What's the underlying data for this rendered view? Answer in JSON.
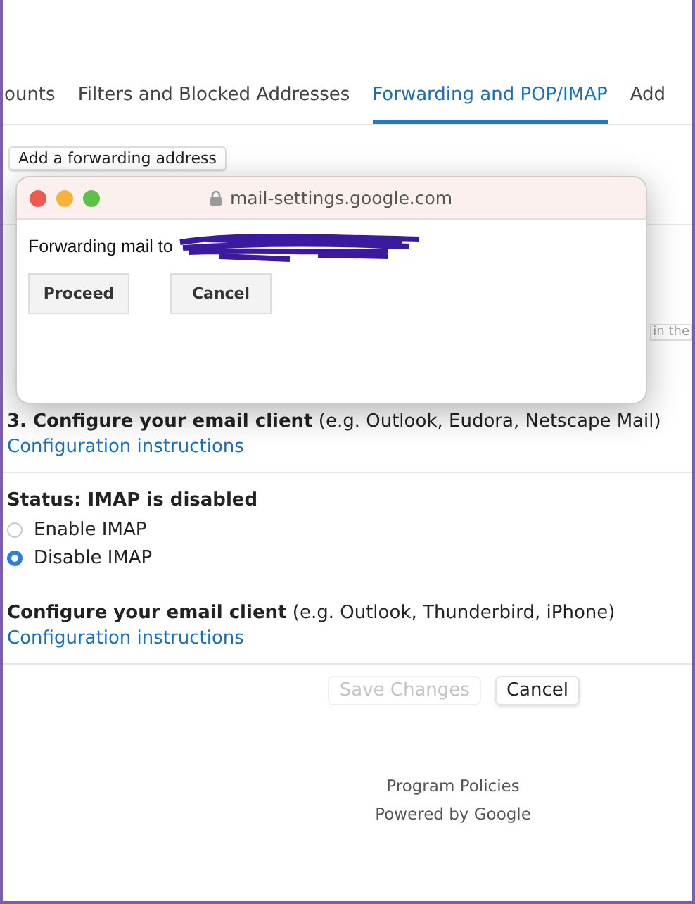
{
  "tabs": [
    {
      "label": "ounts",
      "selected": false
    },
    {
      "label": "Filters and Blocked Addresses",
      "selected": false
    },
    {
      "label": "Forwarding and POP/IMAP",
      "selected": true
    },
    {
      "label": "Add",
      "selected": false
    }
  ],
  "add_forwarding_button": "Add a forwarding address",
  "hidden_fragments": {
    "row_3_right": "in the"
  },
  "popup": {
    "title": "mail-settings.google.com",
    "message": "Forwarding mail to",
    "buttons": [
      "Proceed",
      "Cancel"
    ]
  },
  "pop_section": {
    "heading": "3. Configure your email client",
    "hint": "(e.g. Outlook, Eudora, Netscape Mail)",
    "link": "Configuration instructions"
  },
  "imap_section": {
    "status": "Status: IMAP is disabled",
    "options": [
      {
        "label": "Enable IMAP",
        "selected": false
      },
      {
        "label": "Disable IMAP",
        "selected": true
      }
    ],
    "heading": "Configure your email client",
    "hint": "(e.g. Outlook, Thunderbird, iPhone)",
    "link": "Configuration instructions"
  },
  "actions": [
    {
      "label": "Save Changes",
      "disabled": true
    },
    {
      "label": "Cancel",
      "disabled": false
    }
  ],
  "footer": [
    "Program Policies",
    "Powered by Google"
  ]
}
